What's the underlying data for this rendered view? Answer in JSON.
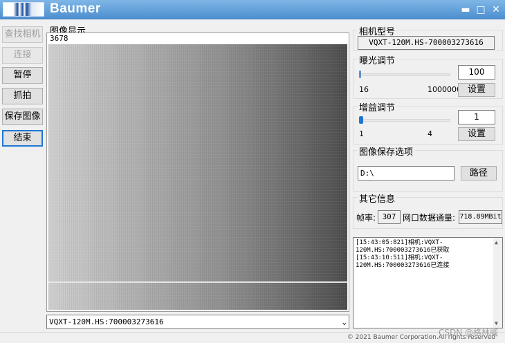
{
  "window": {
    "title": "Baumer",
    "minimize": "▬",
    "maximize": "□",
    "close": "✕"
  },
  "left_buttons": {
    "find_camera": "查找相机",
    "connect": "连接",
    "pause": "暂停",
    "capture": "抓拍",
    "save_image": "保存图像",
    "finish": "结束"
  },
  "image_display": {
    "title": "图像显示",
    "frame_count": "3678"
  },
  "camera_select": {
    "selected": "VQXT-120M.HS:700003273616",
    "arrow": "⌄"
  },
  "camera_model": {
    "title": "相机型号",
    "value": "VQXT-120M.HS-700003273616"
  },
  "exposure": {
    "title": "曝光调节",
    "value": "100",
    "min": "16",
    "max": "1000000",
    "set_label": "设置",
    "slider_fraction": 0.0001
  },
  "gain": {
    "title": "增益调节",
    "value": "1",
    "min": "1",
    "max": "4",
    "set_label": "设置",
    "slider_fraction": 0.0
  },
  "image_save": {
    "title": "图像保存选项",
    "path": "D:\\",
    "path_button": "路径"
  },
  "other_info": {
    "title": "其它信息",
    "frame_rate_label": "帧率:",
    "frame_rate_value": "307",
    "throughput_label": "网口数据通量:",
    "throughput_value": "718.89MBit"
  },
  "log": {
    "lines": [
      "[15:43:05:821]相机:VQXT-",
      "120M.HS:700003273616已获取",
      "[15:43:10:511]相机:VQXT-",
      "120M.HS:700003273616已连接"
    ],
    "scroll_up": "▲",
    "scroll_down": "▼"
  },
  "footer": {
    "copyright": "© 2021 Baumer Corporation.All rights reserved",
    "watermark": "CSDN @格林威"
  },
  "colors": {
    "titlebar": "#4d8fd0",
    "accent": "#1f76d4"
  }
}
